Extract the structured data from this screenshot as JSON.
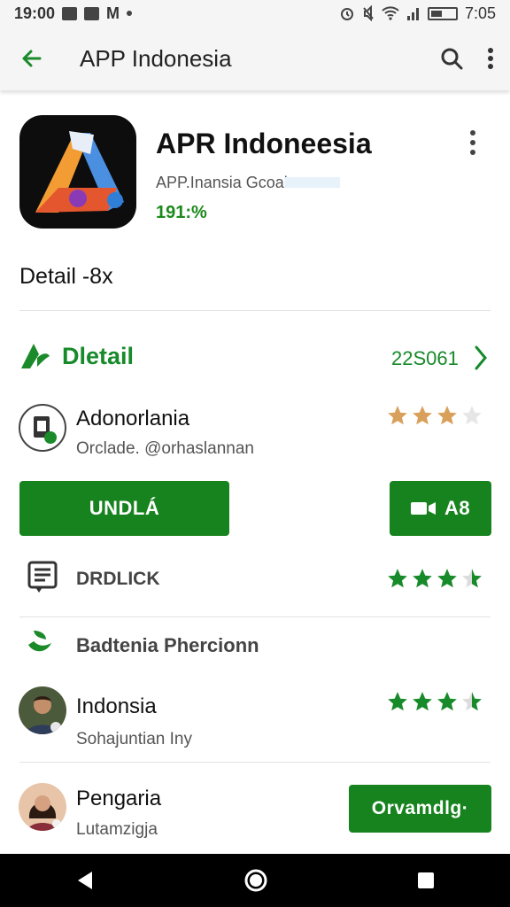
{
  "status_bar": {
    "time_left": "19:00",
    "time_right": "7:05",
    "carrier_letter": "M"
  },
  "app_bar": {
    "title": "APP Indonesia"
  },
  "app": {
    "name": "APR Indoneesia",
    "developer": "APP.Inansia Gcoal",
    "rating_text": "191:%"
  },
  "section": {
    "detail_title": "Detail -8x"
  },
  "detail_header": {
    "label": "Dletail",
    "count": "22S061"
  },
  "rows": [
    {
      "title": "Adonorlania",
      "subtitle": "Orclade. @orhaslannan",
      "stars": 3
    },
    {
      "title": "DRDLICK",
      "stars": 3.5
    },
    {
      "title": "Badtenia Phercionn"
    },
    {
      "title": "Indonsia",
      "subtitle": "Sohajuntian Iny",
      "stars": 3.5
    },
    {
      "title": "Pengaria",
      "subtitle": "Lutamzigja"
    }
  ],
  "buttons": {
    "install": "UNDLÁ",
    "video": "A8",
    "action": "Orvamdlg·"
  },
  "colors": {
    "green": "#17831e",
    "star_orange": "#d9a05b",
    "star_green": "#178a2a"
  },
  "icons": [
    "back-arrow-icon",
    "search-icon",
    "more-vert-icon",
    "chevron-right-icon",
    "video-icon",
    "document-icon",
    "leaf-icon",
    "nav-back-icon",
    "nav-home-icon",
    "nav-recents-icon"
  ]
}
